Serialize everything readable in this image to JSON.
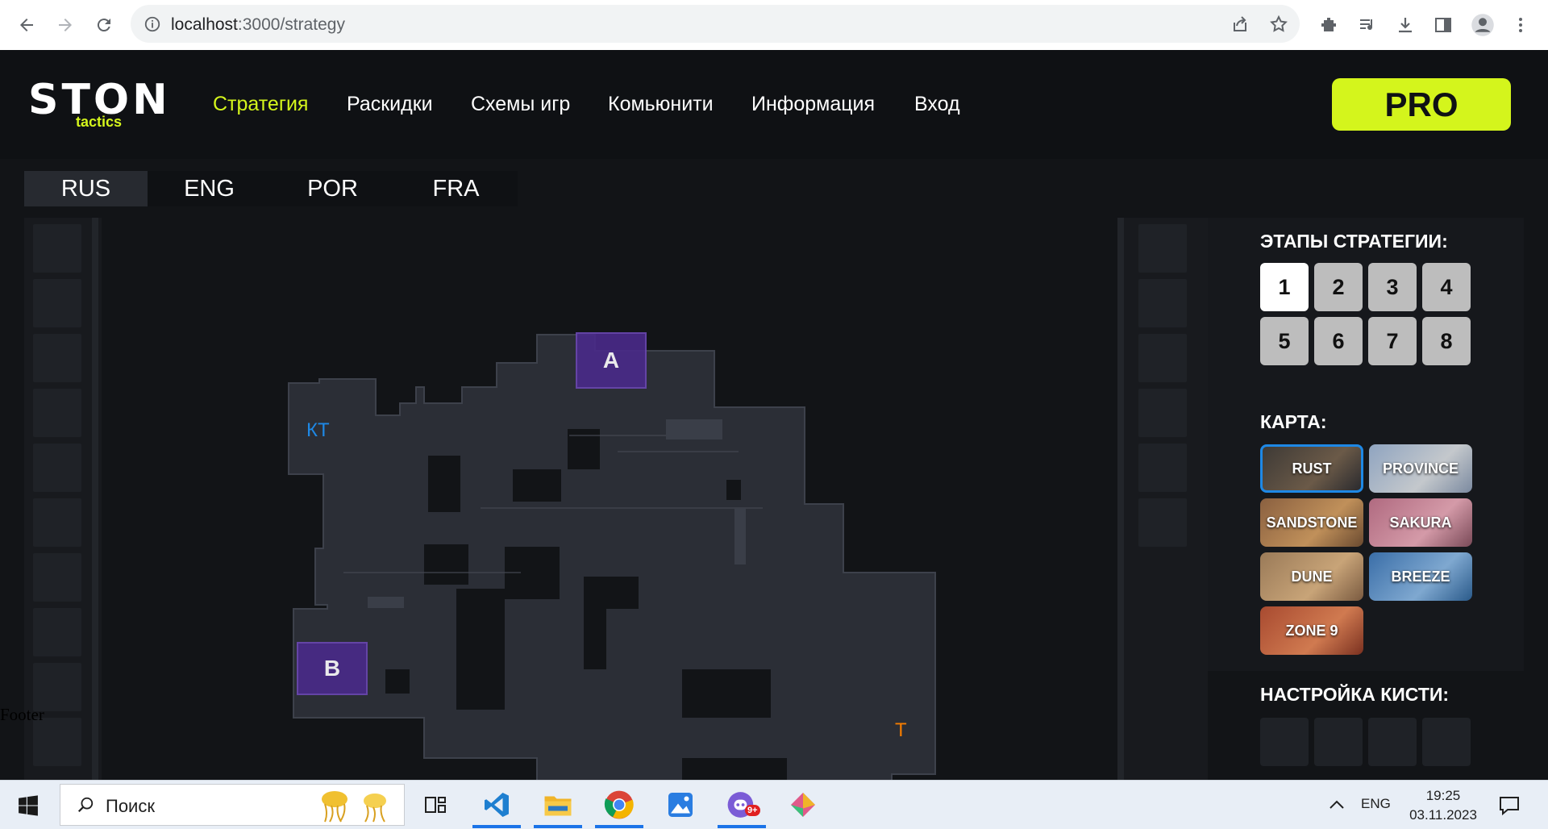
{
  "browser": {
    "url_host": "localhost",
    "url_rest": ":3000/strategy"
  },
  "site": {
    "logo_main": "STON",
    "logo_sub": "tactics",
    "nav": [
      "Стратегия",
      "Раскидки",
      "Схемы игр",
      "Комьюнити",
      "Информация",
      "Вход"
    ],
    "active_nav": "Стратегия",
    "pro_label": "PRO",
    "accent_color": "#d4f51c"
  },
  "languages": [
    "RUS",
    "ENG",
    "POR",
    "FRA"
  ],
  "active_language": "RUS",
  "map": {
    "site_a": "A",
    "site_b": "B",
    "spawn_ct": "КТ",
    "spawn_t": "T",
    "ct_color": "#1e88e5",
    "t_color": "#f57c00"
  },
  "panel": {
    "stages_title": "ЭТАПЫ СТРАТЕГИИ:",
    "stages": [
      "1",
      "2",
      "3",
      "4",
      "5",
      "6",
      "7",
      "8"
    ],
    "active_stage": "1",
    "map_title": "КАРТА:",
    "maps": [
      "RUST",
      "PROVINCE",
      "SANDSTONE",
      "SAKURA",
      "DUNE",
      "BREEZE",
      "ZONE 9"
    ],
    "active_map": "RUST",
    "brush_title": "НАСТРОЙКА КИСТИ:"
  },
  "footer": "Footer",
  "taskbar": {
    "search_placeholder": "Поиск",
    "language": "ENG",
    "time": "19:25",
    "date": "03.11.2023",
    "discord_badge": "9+"
  }
}
